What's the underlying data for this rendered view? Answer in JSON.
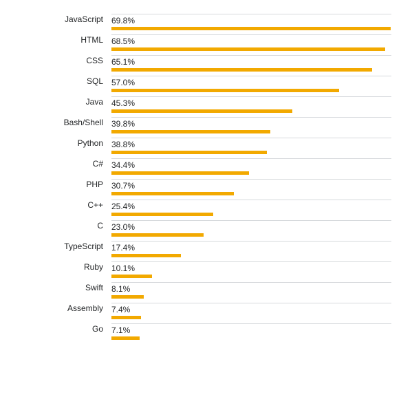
{
  "chart_data": {
    "type": "bar",
    "categories": [
      "JavaScript",
      "HTML",
      "CSS",
      "SQL",
      "Java",
      "Bash/Shell",
      "Python",
      "C#",
      "PHP",
      "C++",
      "C",
      "TypeScript",
      "Ruby",
      "Swift",
      "Assembly",
      "Go"
    ],
    "values": [
      69.8,
      68.5,
      65.1,
      57.0,
      45.3,
      39.8,
      38.8,
      34.4,
      30.7,
      25.4,
      23.0,
      17.4,
      10.1,
      8.1,
      7.4,
      7.1
    ],
    "title": "",
    "xlabel": "",
    "ylabel": "",
    "ylim": [
      0,
      100
    ]
  },
  "rows": [
    {
      "label": "JavaScript",
      "value": "69.8%",
      "pct": 69.8
    },
    {
      "label": "HTML",
      "value": "68.5%",
      "pct": 68.5
    },
    {
      "label": "CSS",
      "value": "65.1%",
      "pct": 65.1
    },
    {
      "label": "SQL",
      "value": "57.0%",
      "pct": 57.0
    },
    {
      "label": "Java",
      "value": "45.3%",
      "pct": 45.3
    },
    {
      "label": "Bash/Shell",
      "value": "39.8%",
      "pct": 39.8
    },
    {
      "label": "Python",
      "value": "38.8%",
      "pct": 38.8
    },
    {
      "label": "C#",
      "value": "34.4%",
      "pct": 34.4
    },
    {
      "label": "PHP",
      "value": "30.7%",
      "pct": 30.7
    },
    {
      "label": "C++",
      "value": "25.4%",
      "pct": 25.4
    },
    {
      "label": "C",
      "value": "23.0%",
      "pct": 23.0
    },
    {
      "label": "TypeScript",
      "value": "17.4%",
      "pct": 17.4
    },
    {
      "label": "Ruby",
      "value": "10.1%",
      "pct": 10.1
    },
    {
      "label": "Swift",
      "value": "8.1%",
      "pct": 8.1
    },
    {
      "label": "Assembly",
      "value": "7.4%",
      "pct": 7.4
    },
    {
      "label": "Go",
      "value": "7.1%",
      "pct": 7.1
    }
  ]
}
